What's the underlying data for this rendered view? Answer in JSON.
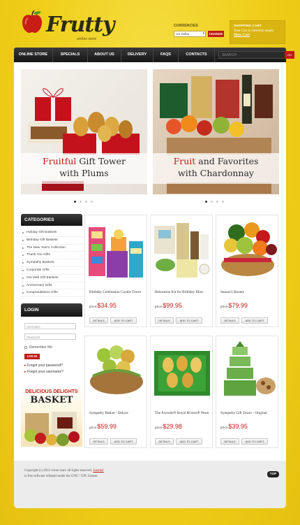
{
  "brand": {
    "name": "Frutty",
    "tagline": "online store"
  },
  "currency": {
    "label": "CURRENCIES",
    "selected": "US Dollar",
    "button": "CHANGE"
  },
  "cart": {
    "title": "SHOPPING CART",
    "message": "Your Cart is currently empty.",
    "link": "Show Cart"
  },
  "nav": {
    "items": [
      "ONLINE STORE",
      "SPECIALS",
      "ABOUT US",
      "DELIVERY",
      "FAQS",
      "CONTACTS"
    ],
    "search_placeholder": "SEARCH",
    "search_button": "GO"
  },
  "slides": [
    {
      "line1_accent": "Fruitful",
      "line1_rest": " Gift Tower",
      "line2": "with Plums"
    },
    {
      "line1_accent": "Fruit",
      "line1_rest": " and Favorites",
      "line2": "with Chardonnay"
    }
  ],
  "categories": {
    "title": "CATEGORIES",
    "items": [
      "Holiday Gift Baskets",
      "Birthday Gift Baskets",
      "The New Year's Collection",
      "Thank You Gifts",
      "Sympathy Baskets",
      "Corporate Gifts",
      "Get Well Gift Baskets",
      "Anniversary Gifts",
      "Congratulations Gifts"
    ]
  },
  "login": {
    "title": "LOGIN",
    "username_placeholder": "Username",
    "password_placeholder": "Password",
    "remember": "Remember Me",
    "button": "LOG IN",
    "forgot_password": "Forgot your password?",
    "forgot_username": "Forgot your username?"
  },
  "promo": {
    "line1": "DELICIOUS DELIGHTS",
    "line2": "BASKET"
  },
  "products": [
    {
      "name": "Birthday Celebration Cookie Tower",
      "price_label": "price:",
      "price": "$34.95"
    },
    {
      "name": "Relaxation Kit for Birthday Bliss",
      "price_label": "price:",
      "price": "$99.95"
    },
    {
      "name": "Season's Bounty",
      "price_label": "price:",
      "price": "$79.99"
    },
    {
      "name": "Sympathy Basket - Deluxe",
      "price_label": "price:",
      "price": "$59.99"
    },
    {
      "name": "The Favorite® Royal Riviera® Pears",
      "price_label": "price:",
      "price": "$29.98"
    },
    {
      "name": "Sympathy Gift Tower - Original",
      "price_label": "price:",
      "price": "$39.95"
    }
  ],
  "product_buttons": {
    "details": "DETAILS",
    "add": "ADD TO CART"
  },
  "footer": {
    "copyright": "Copyright (c) 2012 virtue mart. all rights reserved.",
    "link": "Joomla!",
    "license": "is free software released under the GNU / GPL license.",
    "top": "TOP"
  },
  "colors": {
    "accent": "#c01b15",
    "background": "#f0d21e",
    "nav": "#1f1f1f"
  }
}
